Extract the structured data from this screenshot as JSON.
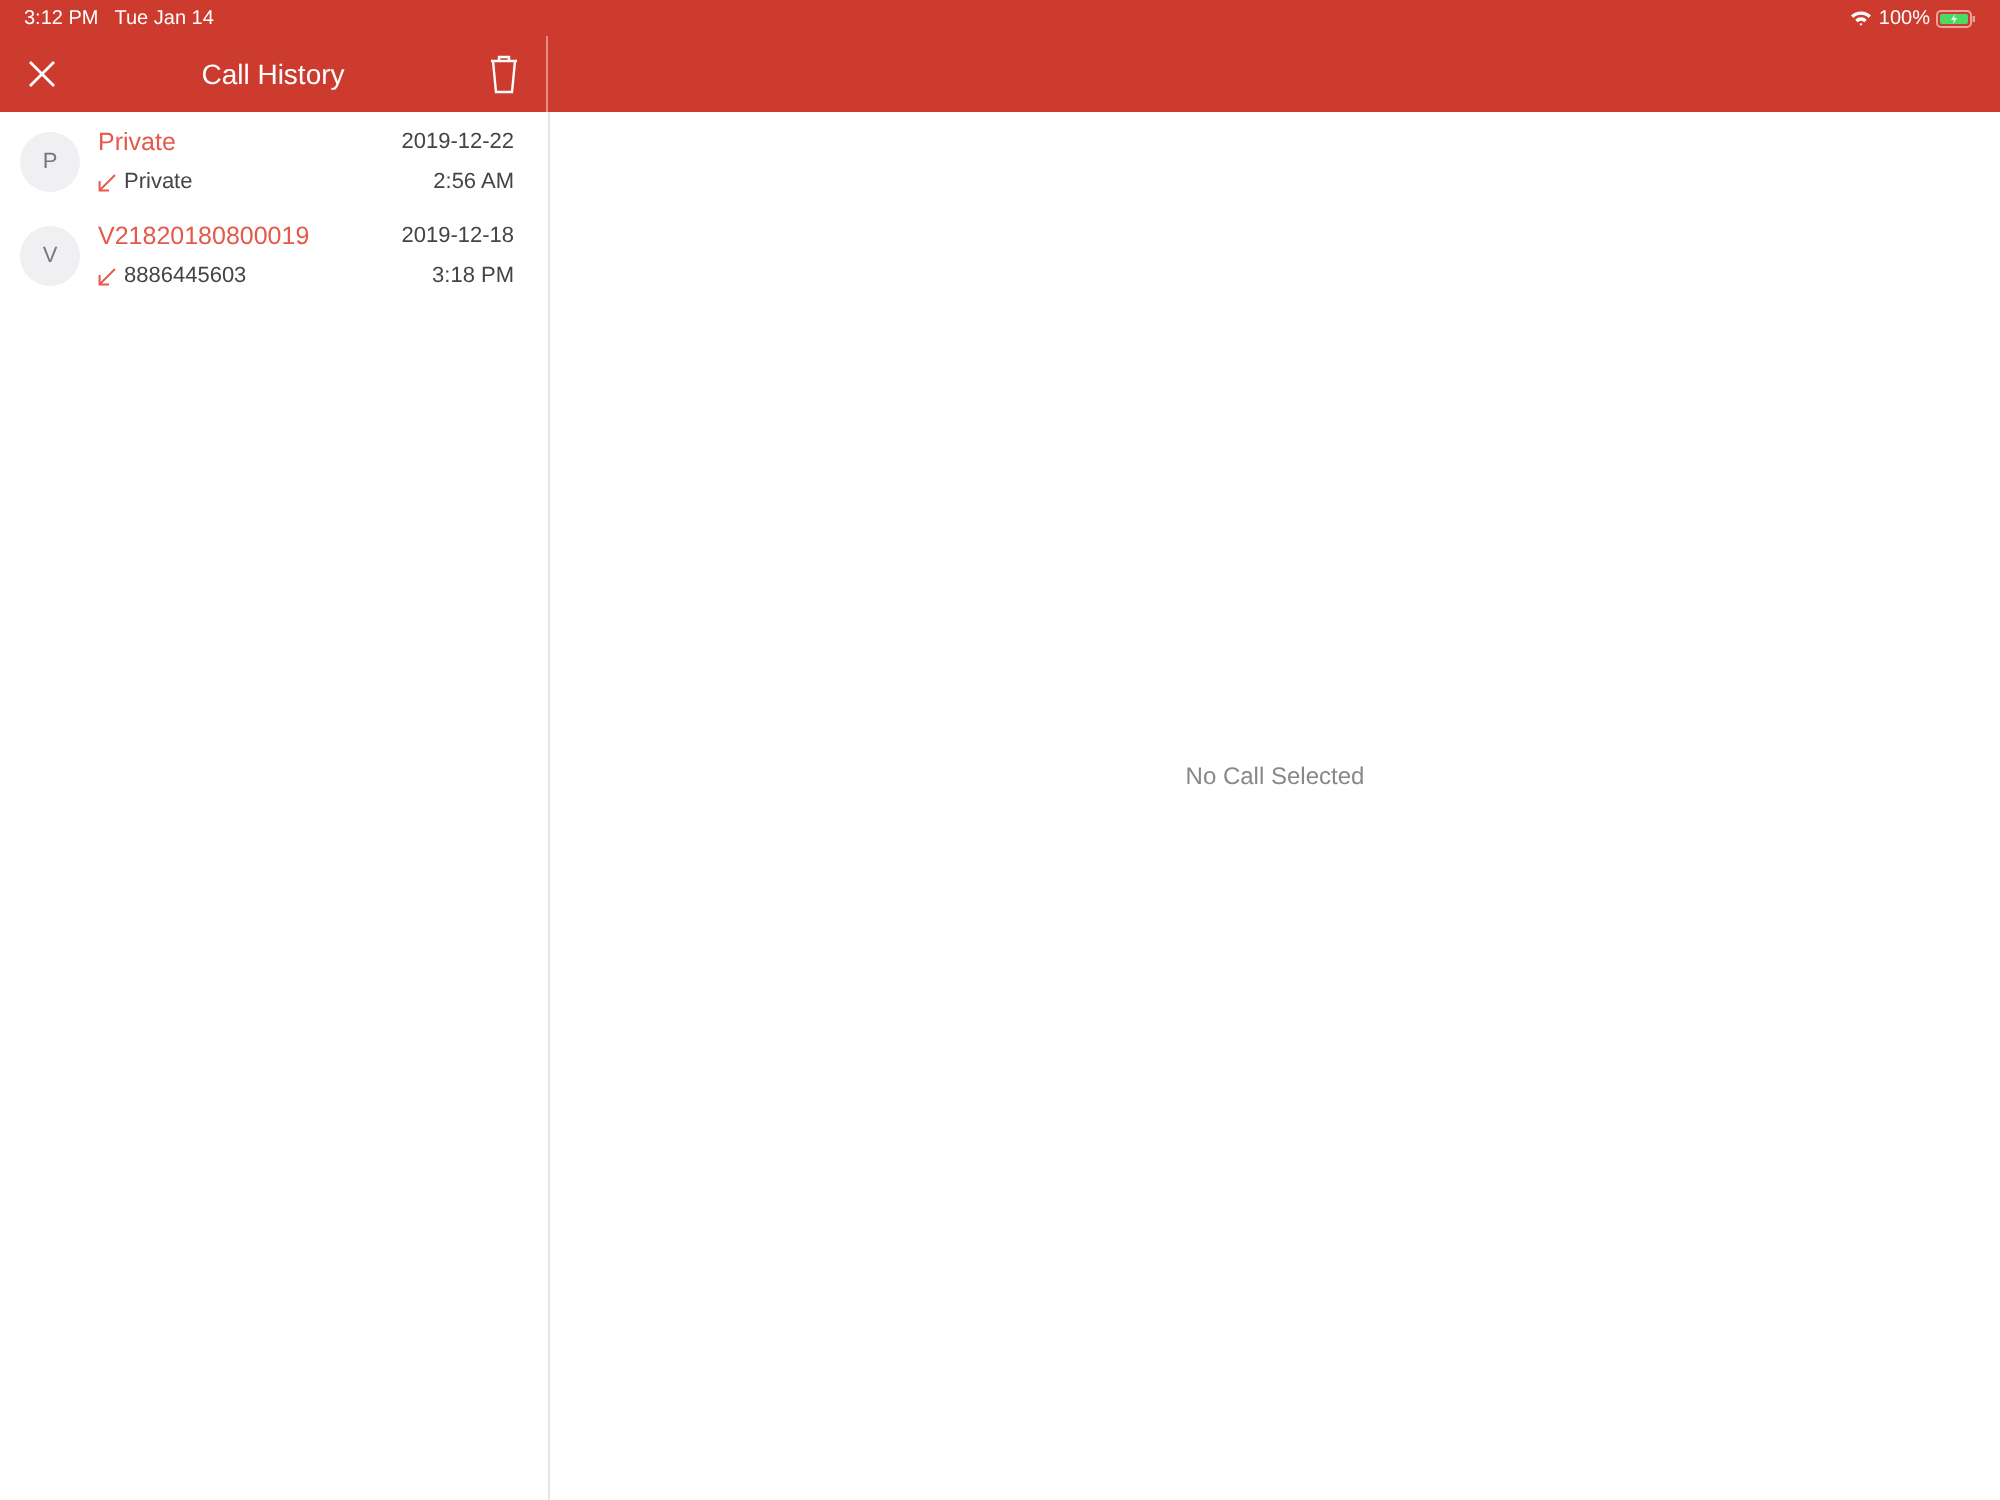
{
  "status_bar": {
    "time": "3:12 PM",
    "date": "Tue Jan 14",
    "battery": "100%"
  },
  "nav": {
    "title": "Call History"
  },
  "calls": [
    {
      "initial": "P",
      "name": "Private",
      "number": "Private",
      "date": "2019-12-22",
      "time": "2:56 AM"
    },
    {
      "initial": "V",
      "name": "V21820180800019",
      "number": "8886445603",
      "date": "2019-12-18",
      "time": "3:18 PM"
    }
  ],
  "detail": {
    "empty_message": "No Call Selected"
  }
}
